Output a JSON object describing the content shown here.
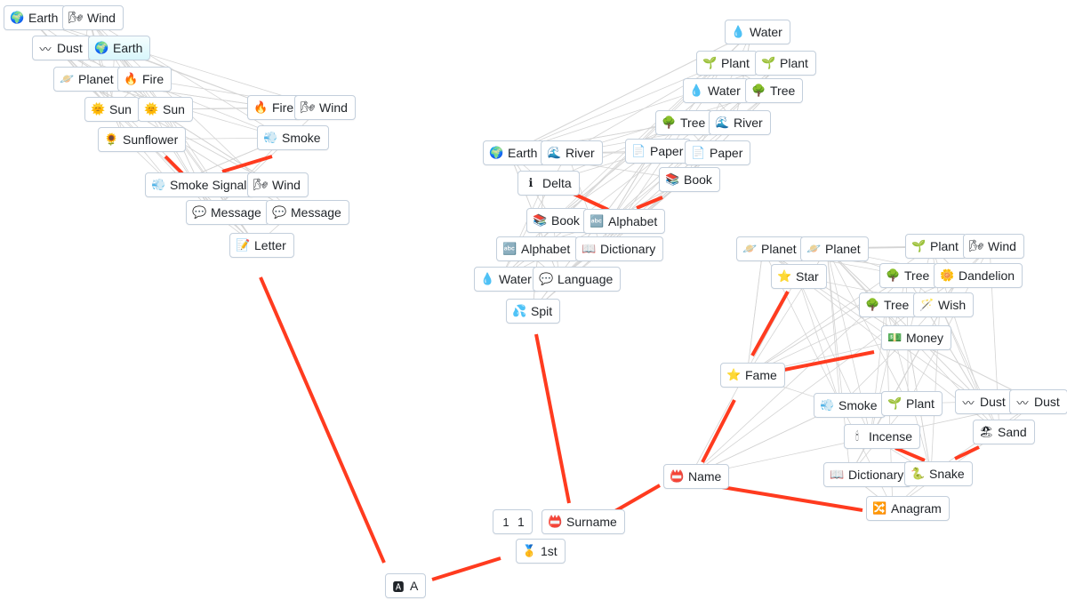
{
  "colors": {
    "highlight_link": "#ff3b1f",
    "link": "#d4d4d4",
    "node_border": "#c3cfdc"
  },
  "nodes": [
    {
      "label": "Earth",
      "icon": "🌍"
    },
    {
      "label": "Wind",
      "icon": "🌬"
    },
    {
      "label": "Dust",
      "icon": "〰"
    },
    {
      "label": "Earth",
      "icon": "🌍",
      "highlighted": true
    },
    {
      "label": "Planet",
      "icon": "🪐"
    },
    {
      "label": "Fire",
      "icon": "🔥"
    },
    {
      "label": "Sun",
      "icon": "🌞"
    },
    {
      "label": "Sun",
      "icon": "🌞"
    },
    {
      "label": "Fire",
      "icon": "🔥"
    },
    {
      "label": "Wind",
      "icon": "🌬"
    },
    {
      "label": "Sunflower",
      "icon": "🌻"
    },
    {
      "label": "Smoke",
      "icon": "💨"
    },
    {
      "label": "Smoke Signal",
      "icon": "💨"
    },
    {
      "label": "Wind",
      "icon": "🌬"
    },
    {
      "label": "Message",
      "icon": "💬"
    },
    {
      "label": "Message",
      "icon": "💬"
    },
    {
      "label": "Letter",
      "icon": "📝"
    },
    {
      "label": "Water",
      "icon": "💧"
    },
    {
      "label": "Plant",
      "icon": "🌱"
    },
    {
      "label": "Plant",
      "icon": "🌱"
    },
    {
      "label": "Water",
      "icon": "💧"
    },
    {
      "label": "Tree",
      "icon": "🌳"
    },
    {
      "label": "Tree",
      "icon": "🌳"
    },
    {
      "label": "River",
      "icon": "🌊"
    },
    {
      "label": "Earth",
      "icon": "🌍"
    },
    {
      "label": "River",
      "icon": "🌊"
    },
    {
      "label": "Paper",
      "icon": "📄"
    },
    {
      "label": "Paper",
      "icon": "📄"
    },
    {
      "label": "Delta",
      "icon": "ℹ"
    },
    {
      "label": "Book",
      "icon": "📚"
    },
    {
      "label": "Book",
      "icon": "📚"
    },
    {
      "label": "Alphabet",
      "icon": "🔤"
    },
    {
      "label": "Alphabet",
      "icon": "🔤"
    },
    {
      "label": "Dictionary",
      "icon": "📖"
    },
    {
      "label": "Water",
      "icon": "💧"
    },
    {
      "label": "Language",
      "icon": "💬"
    },
    {
      "label": "Spit",
      "icon": "💦"
    },
    {
      "label": "Planet",
      "icon": "🪐"
    },
    {
      "label": "Planet",
      "icon": "🪐"
    },
    {
      "label": "Plant",
      "icon": "🌱"
    },
    {
      "label": "Wind",
      "icon": "🌬"
    },
    {
      "label": "Star",
      "icon": "⭐"
    },
    {
      "label": "Tree",
      "icon": "🌳"
    },
    {
      "label": "Dandelion",
      "icon": "🌼"
    },
    {
      "label": "Tree",
      "icon": "🌳"
    },
    {
      "label": "Wish",
      "icon": "🪄"
    },
    {
      "label": "Money",
      "icon": "💵"
    },
    {
      "label": "Fame",
      "icon": "⭐"
    },
    {
      "label": "Smoke",
      "icon": "💨"
    },
    {
      "label": "Plant",
      "icon": "🌱"
    },
    {
      "label": "Dust",
      "icon": "〰"
    },
    {
      "label": "Dust",
      "icon": "〰"
    },
    {
      "label": "Incense",
      "icon": "🕯"
    },
    {
      "label": "Sand",
      "icon": "🏖"
    },
    {
      "label": "Dictionary",
      "icon": "📖"
    },
    {
      "label": "Snake",
      "icon": "🐍"
    },
    {
      "label": "Name",
      "icon": "📛"
    },
    {
      "label": "Anagram",
      "icon": "🔀"
    },
    {
      "label": "1",
      "icon": "1"
    },
    {
      "label": "Surname",
      "icon": "📛"
    },
    {
      "label": "1st",
      "icon": "🥇"
    },
    {
      "label": "A",
      "icon": "🅰"
    }
  ]
}
